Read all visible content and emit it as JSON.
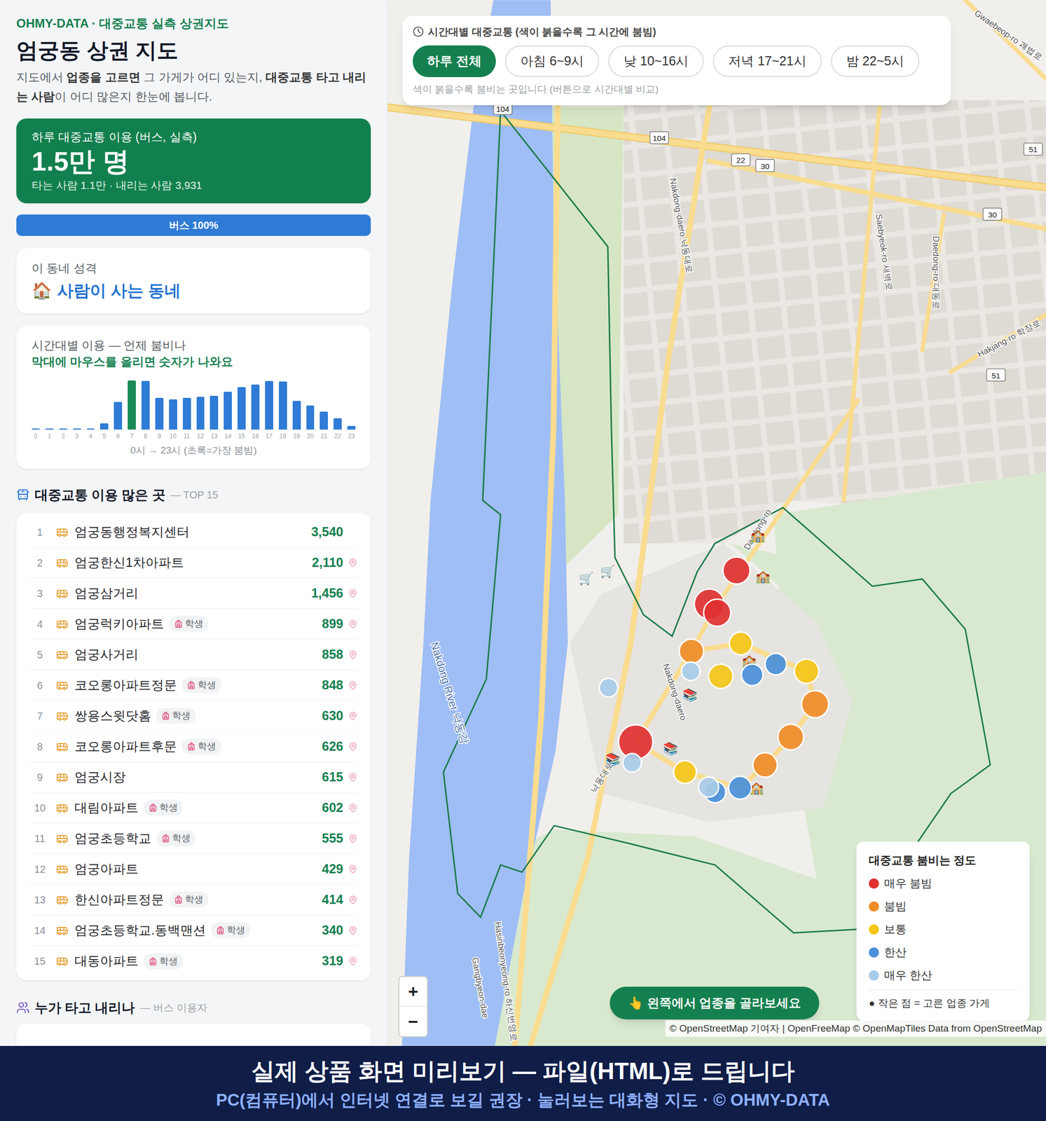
{
  "header": {
    "eyebrow": "OHMY-DATA · 대중교통 실측 상권지도",
    "title": "엄궁동 상권 지도",
    "description": [
      {
        "text": "지도에서 ",
        "bold": false
      },
      {
        "text": "업종을 고르면",
        "bold": true
      },
      {
        "text": " 그 가게가 어디 있는지, ",
        "bold": false
      },
      {
        "text": "대중교통 타고 내리는 사람",
        "bold": true
      },
      {
        "text": "이 어디 많은지 한눈에 봅니다.",
        "bold": false
      }
    ]
  },
  "summary": {
    "label": "하루 대중교통 이용 (버스, 실측)",
    "value": "1.5만 명",
    "detail": "타는 사람 1.1만 · 내리는 사람 3,931"
  },
  "modes": [
    {
      "label": "버스 100%",
      "level": 1,
      "color": "#2f7bd6"
    }
  ],
  "character": {
    "label": "이 동네 성격",
    "icon": "🏠",
    "value": "사람이 사는 동네"
  },
  "hourly": {
    "title": "시간대별 이용 — 언제 붐비나",
    "hint": "막대에 마우스를 올리면 숫자가 나와요",
    "caption": "0시 → 23시 (초록=가장 붐빔)",
    "max": 1200,
    "bars": [
      {
        "hour": "0",
        "value": 30,
        "peak": false
      },
      {
        "hour": "1",
        "value": 30,
        "peak": false
      },
      {
        "hour": "2",
        "value": 30,
        "peak": false
      },
      {
        "hour": "3",
        "value": 30,
        "peak": false
      },
      {
        "hour": "4",
        "value": 30,
        "peak": false
      },
      {
        "hour": "5",
        "value": 150,
        "peak": false
      },
      {
        "hour": "6",
        "value": 670,
        "peak": false
      },
      {
        "hour": "7",
        "value": 1200,
        "peak": true
      },
      {
        "hour": "8",
        "value": 1190,
        "peak": false
      },
      {
        "hour": "9",
        "value": 780,
        "peak": false
      },
      {
        "hour": "10",
        "value": 740,
        "peak": false
      },
      {
        "hour": "11",
        "value": 780,
        "peak": false
      },
      {
        "hour": "12",
        "value": 800,
        "peak": false
      },
      {
        "hour": "13",
        "value": 820,
        "peak": false
      },
      {
        "hour": "14",
        "value": 930,
        "peak": false
      },
      {
        "hour": "15",
        "value": 1040,
        "peak": false
      },
      {
        "hour": "16",
        "value": 1100,
        "peak": false
      },
      {
        "hour": "17",
        "value": 1190,
        "peak": false
      },
      {
        "hour": "18",
        "value": 1180,
        "peak": false
      },
      {
        "hour": "19",
        "value": 700,
        "peak": false
      },
      {
        "hour": "20",
        "value": 590,
        "peak": false
      },
      {
        "hour": "21",
        "value": 440,
        "peak": false
      },
      {
        "hour": "22",
        "value": 270,
        "peak": false
      },
      {
        "hour": "23",
        "value": 90,
        "peak": false
      }
    ]
  },
  "top": {
    "title": "대중교통 이용 많은 곳",
    "subtitle": "— TOP 15",
    "rows": [
      {
        "rank": "1",
        "name": "엄궁동행정복지센터",
        "count": "3,540",
        "tags": [],
        "pin": false
      },
      {
        "rank": "2",
        "name": "엄궁한신1차아파트",
        "count": "2,110",
        "tags": [],
        "pin": true
      },
      {
        "rank": "3",
        "name": "엄궁삼거리",
        "count": "1,456",
        "tags": [],
        "pin": true
      },
      {
        "rank": "4",
        "name": "엄궁럭키아파트",
        "count": "899",
        "tags": [
          "학생"
        ],
        "pin": true
      },
      {
        "rank": "5",
        "name": "엄궁사거리",
        "count": "858",
        "tags": [],
        "pin": true
      },
      {
        "rank": "6",
        "name": "코오롱아파트정문",
        "count": "848",
        "tags": [
          "학생"
        ],
        "pin": true
      },
      {
        "rank": "7",
        "name": "쌍용스윗닷홈",
        "count": "630",
        "tags": [
          "학생"
        ],
        "pin": true
      },
      {
        "rank": "8",
        "name": "코오롱아파트후문",
        "count": "626",
        "tags": [
          "학생"
        ],
        "pin": true
      },
      {
        "rank": "9",
        "name": "엄궁시장",
        "count": "615",
        "tags": [],
        "pin": true
      },
      {
        "rank": "10",
        "name": "대림아파트",
        "count": "602",
        "tags": [
          "학생"
        ],
        "pin": true
      },
      {
        "rank": "11",
        "name": "엄궁초등학교",
        "count": "555",
        "tags": [
          "학생"
        ],
        "pin": true
      },
      {
        "rank": "12",
        "name": "엄궁아파트",
        "count": "429",
        "tags": [],
        "pin": true
      },
      {
        "rank": "13",
        "name": "한신아파트정문",
        "count": "414",
        "tags": [
          "학생"
        ],
        "pin": true
      },
      {
        "rank": "14",
        "name": "엄궁초등학교.동백맨션",
        "count": "340",
        "tags": [
          "학생"
        ],
        "pin": true
      },
      {
        "rank": "15",
        "name": "대동아파트",
        "count": "319",
        "tags": [
          "학생"
        ],
        "pin": true
      }
    ]
  },
  "next_section": {
    "title": "누가 타고 내리나",
    "subtitle": "— 버스 이용자"
  },
  "time_filter": {
    "title": "시간대별 대중교통 (색이 붉을수록 그 시간에 붐빔)",
    "hint": "색이 붉을수록 붐비는 곳입니다 (버튼으로 시간대별 비교)",
    "options": [
      {
        "label": "하루 전체",
        "selected": true
      },
      {
        "label": "아침 6~9시",
        "selected": false
      },
      {
        "label": "낮 10~16시",
        "selected": false
      },
      {
        "label": "저녁 17~21시",
        "selected": false
      },
      {
        "label": "밤 22~5시",
        "selected": false
      }
    ]
  },
  "map": {
    "labels": [
      {
        "text": "Nakdong-daero 낙동대로",
        "kind": "road"
      },
      {
        "text": "Saebyeok-ro 새벽로",
        "kind": "road"
      },
      {
        "text": "Daedong-ro 대동로",
        "kind": "road"
      },
      {
        "text": "Hakjang-ro 학장로",
        "kind": "road"
      },
      {
        "text": "Gwaebeop-ro 괘법로",
        "kind": "road"
      },
      {
        "text": "Daedong-ro",
        "kind": "road"
      },
      {
        "text": "Nakdong-daero",
        "kind": "road"
      },
      {
        "text": "낙동대로",
        "kind": "road"
      },
      {
        "text": "Nakdong River 낙동강",
        "kind": "water"
      },
      {
        "text": "Hasinbeonyeong-ro 하신번영로",
        "kind": "road"
      },
      {
        "text": "Gangbyeon-dae",
        "kind": "road"
      }
    ],
    "shields": [
      "104",
      "104",
      "22",
      "30",
      "30",
      "51",
      "51"
    ],
    "markers": [
      {
        "color": "#e03131",
        "level": 0.58
      },
      {
        "color": "#e03131",
        "level": 0.75
      },
      {
        "color": "#e03131",
        "level": 0.58
      },
      {
        "color": "#f08c28",
        "level": 0.42
      },
      {
        "color": "#f5c518",
        "level": 0.33
      },
      {
        "color": "#a8cbe8",
        "level": 0.08
      },
      {
        "color": "#f5c518",
        "level": 0.42
      },
      {
        "color": "#4a8fd8",
        "level": 0.25
      },
      {
        "color": "#4a8fd8",
        "level": 0.25
      },
      {
        "color": "#f5c518",
        "level": 0.42
      },
      {
        "color": "#f08c28",
        "level": 0.58
      },
      {
        "color": "#f08c28",
        "level": 0.5
      },
      {
        "color": "#a8cbe8",
        "level": 0.08
      },
      {
        "color": "#e03131",
        "level": 1
      },
      {
        "color": "#a8cbe8",
        "level": 0.08
      },
      {
        "color": "#f5c518",
        "level": 0.33
      },
      {
        "color": "#f08c28",
        "level": 0.42
      },
      {
        "color": "#4a8fd8",
        "level": 0.33
      },
      {
        "color": "#4a8fd8",
        "level": 0.25
      },
      {
        "color": "#a8cbe8",
        "level": 0.17
      }
    ],
    "pois": [
      "🏫",
      "🏫",
      "🏫",
      "🏫",
      "🛒",
      "🛒",
      "📚",
      "📚",
      "📚"
    ],
    "zoom": [
      "+",
      "−"
    ],
    "cta": "👆 왼쪽에서 업종을 골라보세요",
    "attribution": "© OpenStreetMap 기여자 | OpenFreeMap © OpenMapTiles Data from OpenStreetMap"
  },
  "legend": {
    "title": "대중교통 붐비는 정도",
    "items": [
      {
        "label": "매우 붐빔",
        "color": "#e03131"
      },
      {
        "label": "붐빔",
        "color": "#f08c28"
      },
      {
        "label": "보통",
        "color": "#f5c518"
      },
      {
        "label": "한산",
        "color": "#4a8fd8"
      },
      {
        "label": "매우 한산",
        "color": "#a8cbe8"
      }
    ],
    "note": "● 작은 점 = 고른 업종 가게"
  },
  "footer": {
    "title": "실제 상품 화면 미리보기 — 파일(HTML)로 드립니다",
    "subtitle": "PC(컴퓨터)에서 인터넷 연결로 보길 권장 · 눌러보는 대화형 지도 · © OHMY-DATA"
  }
}
